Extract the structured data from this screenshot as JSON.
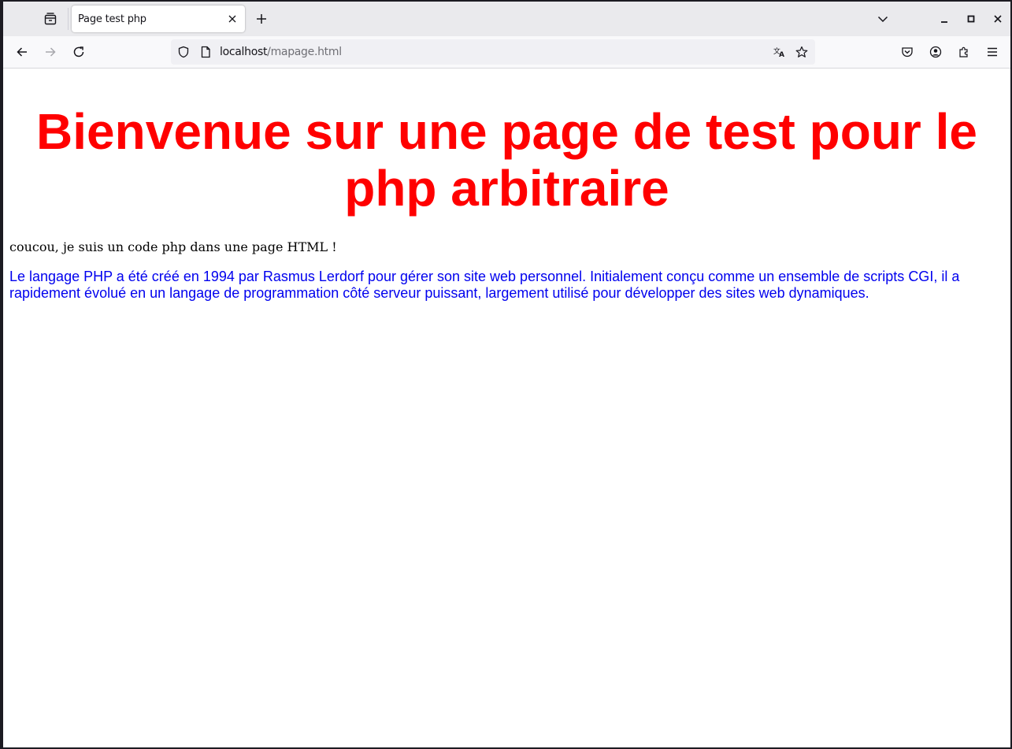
{
  "browser": {
    "tab": {
      "title": "Page test php"
    },
    "url": {
      "host": "localhost",
      "path": "/mapage.html"
    },
    "icons": {
      "tab_list": "tab-list-icon",
      "close_tab": "close-icon",
      "new_tab": "plus-icon",
      "tabs_menu": "chevron-down-icon",
      "minimize": "minimize-icon",
      "maximize": "maximize-icon",
      "close_window": "close-icon",
      "back": "arrow-left-icon",
      "forward": "arrow-right-icon",
      "reload": "reload-icon",
      "tracking_protection": "shield-icon",
      "page_info": "page-icon",
      "translate": "translate-icon",
      "bookmark": "star-icon",
      "pocket": "pocket-icon",
      "account": "account-icon",
      "extensions": "puzzle-icon",
      "menu": "hamburger-icon"
    }
  },
  "page": {
    "heading": "Bienvenue sur une page de test pour le php arbitraire",
    "php_output": "coucou, je suis un code php dans une page HTML !",
    "history_text": "Le langage PHP a été créé en 1994 par Rasmus Lerdorf pour gérer son site web personnel. Initialement conçu comme un ensemble de scripts CGI, il a rapidement évolué en un langage de programmation côté serveur puissant, largement utilisé pour développer des sites web dynamiques."
  },
  "colors": {
    "heading": "#ff0000",
    "history_text": "#0000ee",
    "php_output": "#000000"
  }
}
